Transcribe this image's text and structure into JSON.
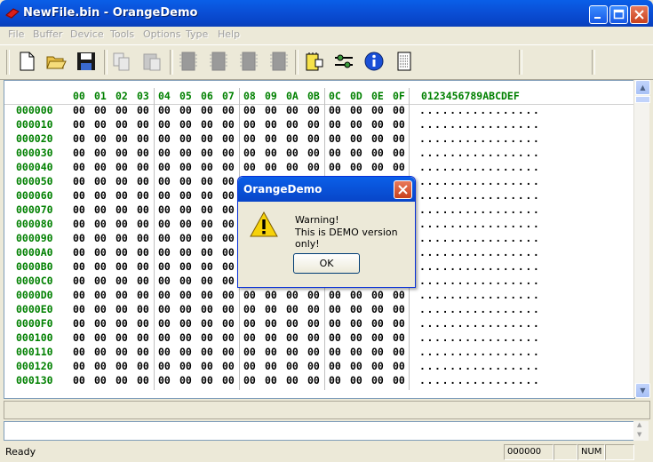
{
  "window": {
    "title": "NewFile.bin - OrangeDemo"
  },
  "menu": [
    "File",
    "Buffer",
    "Device",
    "Tools",
    "Options",
    "Type",
    "Help"
  ],
  "toolbar": {
    "icons": [
      "new-file-icon",
      "open-folder-icon",
      "save-icon",
      "copy-icon",
      "paste-icon",
      "chip-icon",
      "chip-icon",
      "chip-icon",
      "chip-icon",
      "device-info-icon",
      "settings-icon",
      "info-icon",
      "notes-icon"
    ]
  },
  "hex": {
    "columns": [
      "00",
      "01",
      "02",
      "03",
      "04",
      "05",
      "06",
      "07",
      "08",
      "09",
      "0A",
      "0B",
      "0C",
      "0D",
      "0E",
      "0F"
    ],
    "ascii_header": "0123456789ABCDEF",
    "offsets": [
      "000000",
      "000010",
      "000020",
      "000030",
      "000040",
      "000050",
      "000060",
      "000070",
      "000080",
      "000090",
      "0000A0",
      "0000B0",
      "0000C0",
      "0000D0",
      "0000E0",
      "0000F0",
      "000100",
      "000110",
      "000120",
      "000130"
    ],
    "byte_value": "00",
    "ascii_row": "................"
  },
  "status": {
    "text": "Ready",
    "address": "000000",
    "num": "NUM"
  },
  "dialog": {
    "title": "OrangeDemo",
    "line1": "Warning!",
    "line2": "This is DEMO version only!",
    "ok_label": "OK"
  },
  "colors": {
    "offset_green": "#008000",
    "titlebar_blue": "#0a4fd6"
  }
}
